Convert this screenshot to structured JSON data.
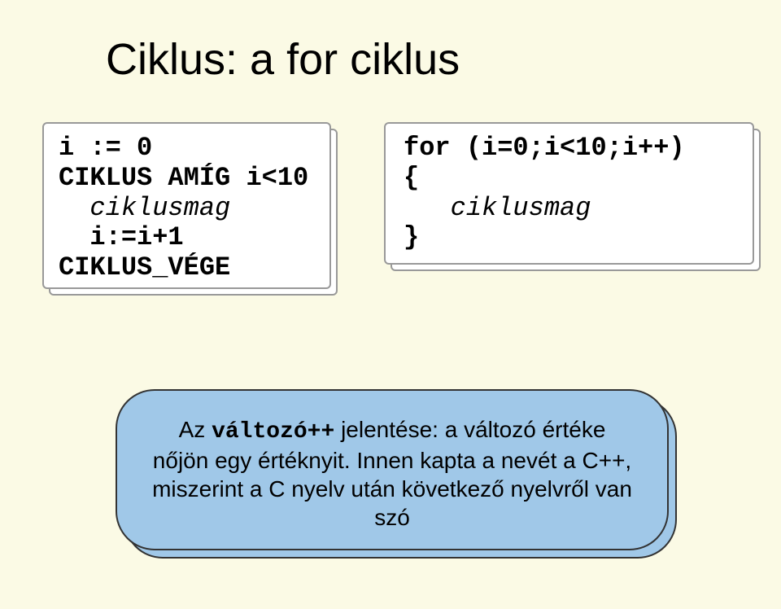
{
  "title": "Ciklus: a for ciklus",
  "pseudocode": {
    "line1": "i := 0",
    "line2": "CIKLUS AMÍG i<10",
    "line3": "  ciklusmag",
    "line4": "  i:=i+1",
    "line5": "CIKLUS_VÉGE"
  },
  "ccode": {
    "line1": "for (i=0;i<10;i++)",
    "line2": "{",
    "line3": "   ciklusmag",
    "line4": "}"
  },
  "note": {
    "prefix": "Az ",
    "bold": "változó++",
    "rest": " jelentése: a változó értéke nőjön egy értéknyit. Innen kapta a nevét a C++, miszerint a C nyelv után következő nyelvről van szó"
  }
}
